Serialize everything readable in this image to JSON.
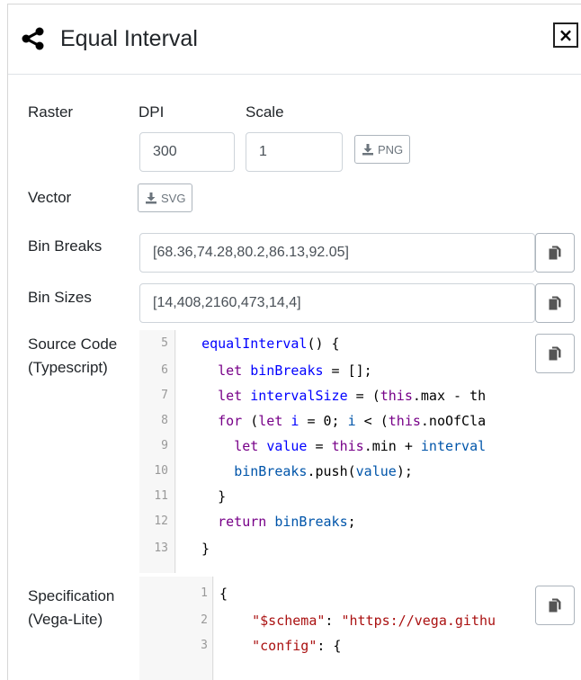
{
  "header": {
    "title": "Equal Interval",
    "close_label": "×"
  },
  "raster": {
    "label": "Raster",
    "dpi_label": "DPI",
    "scale_label": "Scale",
    "dpi_value": "300",
    "scale_value": "1",
    "png_button": "PNG"
  },
  "vector": {
    "label": "Vector",
    "svg_button": "SVG"
  },
  "bin_breaks": {
    "label": "Bin Breaks",
    "value": "[68.36,74.28,80.2,86.13,92.05]"
  },
  "bin_sizes": {
    "label": "Bin Sizes",
    "value": "[14,408,2160,473,14,4]"
  },
  "source_code": {
    "label_line1": "Source Code",
    "label_line2": "(Typescript)",
    "line_numbers": [
      "5",
      "6",
      "7",
      "8",
      "9",
      "10",
      "11",
      "12",
      "13"
    ]
  },
  "specification": {
    "label_line1": "Specification",
    "label_line2": "(Vega-Lite)",
    "line_numbers": [
      "1",
      "2",
      "3"
    ]
  }
}
